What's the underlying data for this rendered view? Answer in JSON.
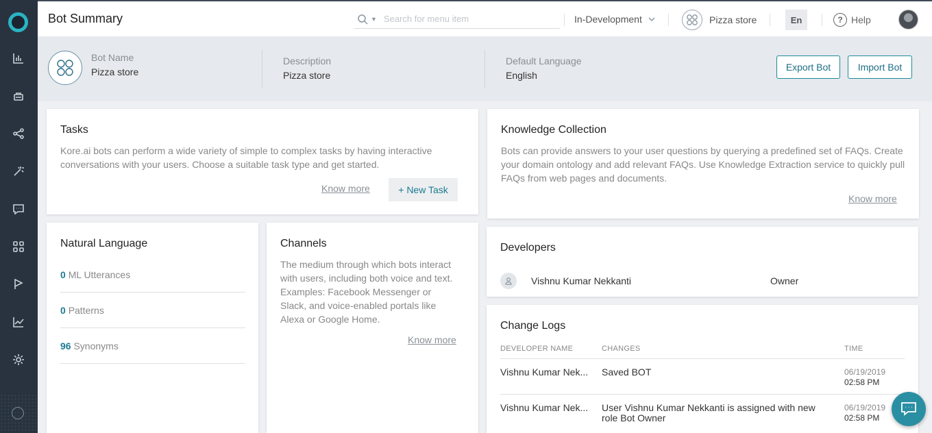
{
  "header": {
    "title": "Bot Summary",
    "search_placeholder": "Search for menu item",
    "environment": "In-Development",
    "bot_name": "Pizza store",
    "language": "En",
    "help": "Help"
  },
  "bot_info": {
    "name_label": "Bot Name",
    "name_value": "Pizza store",
    "description_label": "Description",
    "description_value": "Pizza store",
    "language_label": "Default Language",
    "language_value": "English",
    "export_label": "Export Bot",
    "import_label": "Import Bot"
  },
  "tasks": {
    "title": "Tasks",
    "description": "Kore.ai bots can perform a wide variety of simple to complex tasks by having interactive conversations with your users. Choose a suitable task type and get started.",
    "know_more": "Know more",
    "new_task": "+ New Task"
  },
  "knowledge": {
    "title": "Knowledge Collection",
    "description": "Bots can provide answers to your user questions by querying a predefined set of FAQs. Create your domain ontology and add relevant FAQs. Use Knowledge Extraction service to quickly pull FAQs from web pages and documents.",
    "know_more": "Know more"
  },
  "natural_language": {
    "title": "Natural Language",
    "stats": [
      {
        "count": "0",
        "label": "ML Utterances"
      },
      {
        "count": "0",
        "label": "Patterns"
      },
      {
        "count": "96",
        "label": "Synonyms"
      }
    ]
  },
  "channels": {
    "title": "Channels",
    "description": "The medium through which bots interact with users, including both voice and text. Examples: Facebook Messenger or Slack, and voice-enabled portals like Alexa or Google Home.",
    "know_more": "Know more"
  },
  "developers": {
    "title": "Developers",
    "rows": [
      {
        "name": "Vishnu Kumar Nekkanti",
        "role": "Owner"
      }
    ]
  },
  "change_logs": {
    "title": "Change Logs",
    "columns": {
      "developer": "DEVELOPER NAME",
      "changes": "CHANGES",
      "time": "TIME"
    },
    "rows": [
      {
        "developer": "Vishnu Kumar Nek...",
        "change": "Saved BOT",
        "date": "06/19/2019",
        "time": "02:58 PM"
      },
      {
        "developer": "Vishnu Kumar Nek...",
        "change": "User Vishnu Kumar Nekkanti is assigned with new role Bot Owner",
        "date": "06/19/2019",
        "time": "02:58 PM"
      }
    ]
  },
  "colors": {
    "sidebar": "#28333f",
    "accent": "#1d7b92",
    "logo_ring": "#2bb3c3"
  },
  "icons": [
    "summary-chart-icon",
    "bot-builder-icon",
    "flows-icon",
    "magic-wand-icon",
    "chat-icon",
    "apps-grid-icon",
    "flag-icon",
    "analytics-icon",
    "settings-gear-icon"
  ]
}
